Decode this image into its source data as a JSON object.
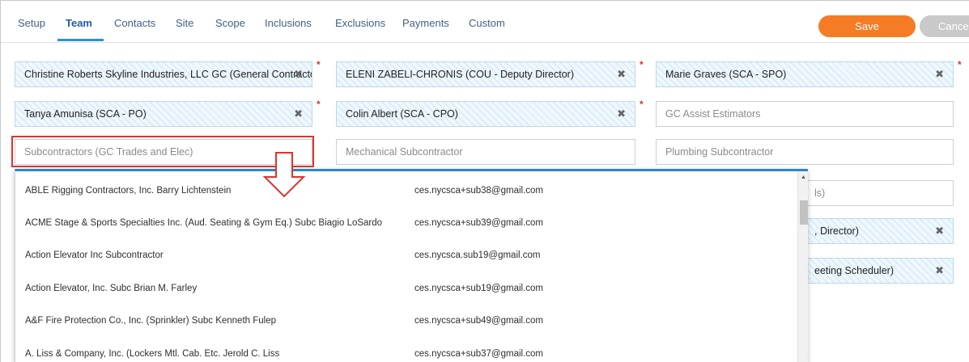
{
  "tabs": [
    {
      "label": "Setup"
    },
    {
      "label": "Team"
    },
    {
      "label": "Contacts"
    },
    {
      "label": "Site"
    },
    {
      "label": "Scope"
    },
    {
      "label": "Inclusions"
    },
    {
      "label": "Exclusions"
    },
    {
      "label": "Payments"
    },
    {
      "label": "Custom"
    }
  ],
  "active_tab": "Team",
  "buttons": {
    "save": "Save",
    "cancel": "Cancel"
  },
  "fields": {
    "r1c1": {
      "value": "Christine Roberts Skyline Industries, LLC GC (General Contracto"
    },
    "r1c2": {
      "value": "ELENI ZABELI-CHRONIS (COU - Deputy Director)"
    },
    "r1c3": {
      "value": "Marie Graves (SCA - SPO)"
    },
    "r2c1": {
      "value": "Tanya Amunisa (SCA - PO)"
    },
    "r2c2": {
      "value": "Colin Albert (SCA - CPO)"
    },
    "r2c3": {
      "placeholder": "GC Assist Estimators"
    },
    "r3c1": {
      "placeholder": "Subcontractors (GC Trades and Elec)"
    },
    "r3c2": {
      "placeholder": "Mechanical Subcontractor"
    },
    "r3c3": {
      "placeholder": "Plumbing Subcontractor"
    },
    "r4c3_partial": {
      "text": "ls)"
    },
    "r5c3_partial": {
      "text": ", Director)"
    },
    "r6c3_partial": {
      "text": "eeting Scheduler)"
    }
  },
  "required_mark": "*",
  "remove_glyph": "✖",
  "dropdown_options": [
    {
      "name": "ABLE Rigging Contractors, Inc. Barry Lichtenstein",
      "email": "ces.nycsca+sub38@gmail.com"
    },
    {
      "name": "ACME Stage & Sports Specialties Inc. (Aud. Seating & Gym Eq.) Subc Biagio LoSardo",
      "email": "ces.nycsca+sub39@gmail.com"
    },
    {
      "name": "Action Elevator Inc Subcontractor",
      "email": "ces.nycsca.sub19@gmail.com"
    },
    {
      "name": "Action Elevator, Inc. Subc Brian M. Farley",
      "email": "ces.nycsca+sub19@gmail.com"
    },
    {
      "name": "A&F Fire Protection Co., Inc. (Sprinkler) Subc Kenneth Fulep",
      "email": "ces.nycsca+sub49@gmail.com"
    },
    {
      "name": "A. Liss & Company, Inc. (Lockers Mtl. Cab. Etc. Jerold C. Liss",
      "email": "ces.nycsca+sub37@gmail.com"
    }
  ],
  "colors": {
    "accent": "#2d8fd5",
    "save": "#f57c24",
    "highlight": "#e1322d"
  }
}
